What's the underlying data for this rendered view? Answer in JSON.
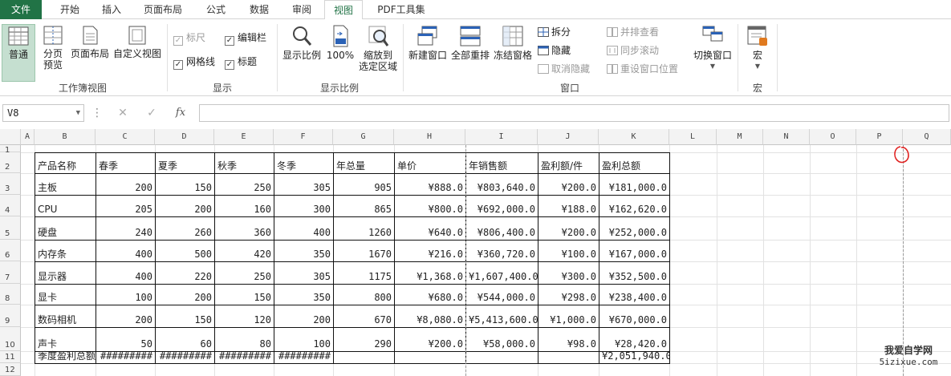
{
  "tabs": [
    "文件",
    "开始",
    "插入",
    "页面布局",
    "公式",
    "数据",
    "审阅",
    "视图",
    "PDF工具集"
  ],
  "active_tab": "视图",
  "ribbon": {
    "workbook_views": {
      "label": "工作簿视图",
      "normal": "普通",
      "page_break_1": "分页",
      "page_break_2": "预览",
      "page_layout": "页面布局",
      "custom_views": "自定义视图"
    },
    "show": {
      "label": "显示",
      "ruler": "标尺",
      "formula_bar": "编辑栏",
      "gridlines": "网格线",
      "headings": "标题",
      "check": "✓"
    },
    "zoom": {
      "label": "显示比例",
      "zoom": "显示比例",
      "hundred": "100%",
      "zoom_sel_1": "缩放到",
      "zoom_sel_2": "选定区域"
    },
    "window": {
      "label": "窗口",
      "new_window": "新建窗口",
      "arrange_all": "全部重排",
      "freeze": "冻结窗格",
      "split": "拆分",
      "hide": "隐藏",
      "unhide": "取消隐藏",
      "side_by_side": "并排查看",
      "sync_scroll": "同步滚动",
      "reset_pos": "重设窗口位置",
      "switch": "切换窗口"
    },
    "macros": {
      "label": "宏",
      "macros": "宏"
    }
  },
  "formula_bar": {
    "name_box": "V8",
    "cancel": "✕",
    "enter": "✓",
    "fx": "fx",
    "dots": "⋮"
  },
  "columns": [
    "A",
    "B",
    "C",
    "D",
    "E",
    "F",
    "G",
    "H",
    "I",
    "J",
    "K",
    "L",
    "M",
    "N",
    "O",
    "P",
    "Q"
  ],
  "rows": [
    "1",
    "2",
    "3",
    "4",
    "5",
    "6",
    "7",
    "8",
    "9",
    "10",
    "11",
    "12"
  ],
  "table": {
    "headers": [
      "产品名称",
      "春季",
      "夏季",
      "秋季",
      "冬季",
      "年总量",
      "单价",
      "年销售额",
      "盈利额/件",
      "盈利总额"
    ],
    "data": [
      [
        "主板",
        "200",
        "150",
        "250",
        "305",
        "905",
        "¥888.0",
        "¥803,640.0",
        "¥200.0",
        "¥181,000.0"
      ],
      [
        "CPU",
        "205",
        "200",
        "160",
        "300",
        "865",
        "¥800.0",
        "¥692,000.0",
        "¥188.0",
        "¥162,620.0"
      ],
      [
        "硬盘",
        "240",
        "260",
        "360",
        "400",
        "1260",
        "¥640.0",
        "¥806,400.0",
        "¥200.0",
        "¥252,000.0"
      ],
      [
        "内存条",
        "400",
        "500",
        "420",
        "350",
        "1670",
        "¥216.0",
        "¥360,720.0",
        "¥100.0",
        "¥167,000.0"
      ],
      [
        "显示器",
        "400",
        "220",
        "250",
        "305",
        "1175",
        "¥1,368.0",
        "¥1,607,400.0",
        "¥300.0",
        "¥352,500.0"
      ],
      [
        "显卡",
        "100",
        "200",
        "150",
        "350",
        "800",
        "¥680.0",
        "¥544,000.0",
        "¥298.0",
        "¥238,400.0"
      ],
      [
        "数码相机",
        "200",
        "150",
        "120",
        "200",
        "670",
        "¥8,080.0",
        "¥5,413,600.0",
        "¥1,000.0",
        "¥670,000.0"
      ],
      [
        "声卡",
        "50",
        "60",
        "80",
        "100",
        "290",
        "¥200.0",
        "¥58,000.0",
        "¥98.0",
        "¥28,420.0"
      ]
    ],
    "total_row": [
      "季度盈利总额",
      "#########",
      "#########",
      "#########",
      "#########",
      "",
      "",
      "",
      "",
      "¥2,051,940.0"
    ]
  },
  "watermark": {
    "line1": "我爱自学网",
    "line2": "5izixue.com"
  },
  "colors": {
    "excel_green": "#217346",
    "annotation": "#e0201f"
  }
}
